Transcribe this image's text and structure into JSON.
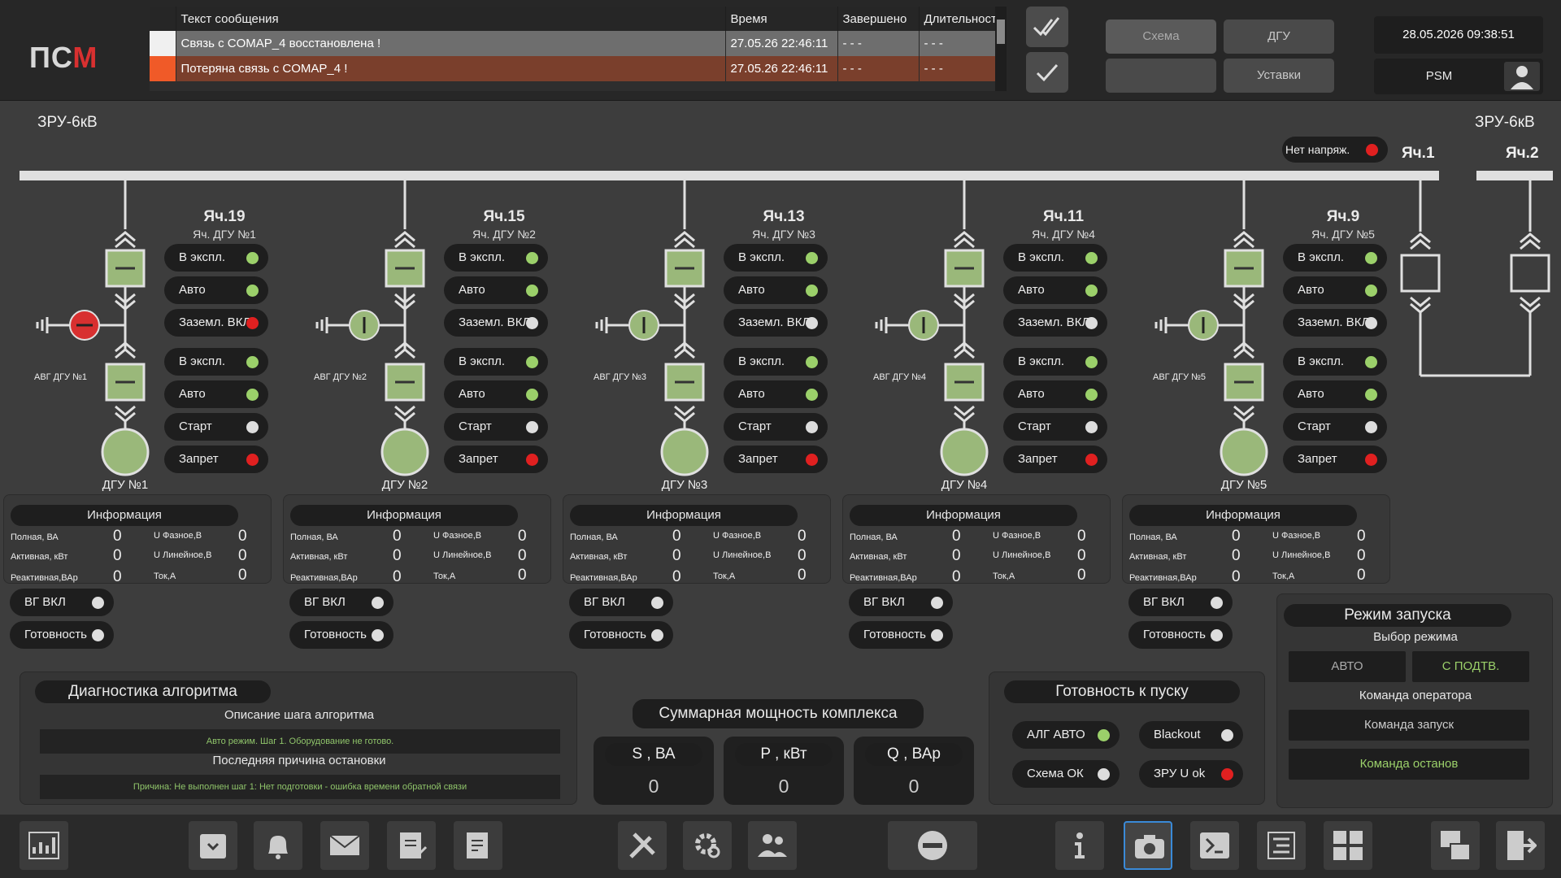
{
  "header": {
    "logo": {
      "left": "ПС",
      "right": "М"
    },
    "alarm_table": {
      "columns": [
        "Текст сообщения",
        "Время",
        "Завершено",
        "Длительность"
      ],
      "rows": [
        {
          "color": "#f0f0f0",
          "text": "Связь с COMAP_4 восстановлена !",
          "time": "27.05.26  22:46:11",
          "done": "- - -",
          "duration": "- - -"
        },
        {
          "color": "#f05a28",
          "text": "Потеряна связь с COMAP_4 !",
          "time": "27.05.26  22:46:11",
          "done": "- - -",
          "duration": "- - -"
        }
      ]
    },
    "nav": {
      "schema": "Схема",
      "dgu": "ДГУ",
      "empty": "",
      "settings": "Уставки"
    },
    "datetime": "28.05.2026  09:38:51",
    "user": "PSM"
  },
  "board": {
    "title_left": "ЗРУ-6кВ",
    "title_right": "ЗРУ-6кВ",
    "no_voltage": "Нет напряж.",
    "cell1": "Яч.1",
    "cell2": "Яч.2"
  },
  "units": [
    {
      "cell": "Яч.19",
      "sub": "Яч. ДГУ №1",
      "avg": "АВГ ДГУ №1",
      "dgu": "ДГУ №1",
      "top": [
        {
          "label": "В экспл.",
          "led": "g"
        },
        {
          "label": "Авто",
          "led": "g"
        },
        {
          "label": "Заземл. ВКЛ",
          "led": "r"
        }
      ],
      "bot": [
        {
          "label": "В экспл.",
          "led": "g"
        },
        {
          "label": "Авто",
          "led": "g"
        },
        {
          "label": "Старт",
          "led": "w"
        },
        {
          "label": "Запрет",
          "led": "r"
        }
      ],
      "ground": "red",
      "info": {
        "title": "Информация",
        "full": "Полная, ВА",
        "active": "Активная, кВт",
        "reactive": "Реактивная,ВАр",
        "uph": "U Фазное,В",
        "ulin": "U Линейное,В",
        "cur": "Ток,А",
        "v_full": "0",
        "v_active": "0",
        "v_reactive": "0",
        "v_uph": "0",
        "v_ulin": "0",
        "v_cur": "0"
      },
      "vg": "ВГ ВКЛ",
      "ready": "Готовность"
    },
    {
      "cell": "Яч.15",
      "sub": "Яч. ДГУ №2",
      "avg": "АВГ ДГУ №2",
      "dgu": "ДГУ №2",
      "top": [
        {
          "label": "В экспл.",
          "led": "g"
        },
        {
          "label": "Авто",
          "led": "g"
        },
        {
          "label": "Заземл. ВКЛ",
          "led": "w"
        }
      ],
      "bot": [
        {
          "label": "В экспл.",
          "led": "g"
        },
        {
          "label": "Авто",
          "led": "g"
        },
        {
          "label": "Старт",
          "led": "w"
        },
        {
          "label": "Запрет",
          "led": "r"
        }
      ],
      "ground": "green",
      "info": {
        "title": "Информация",
        "full": "Полная, ВА",
        "active": "Активная, кВт",
        "reactive": "Реактивная,ВАр",
        "uph": "U Фазное,В",
        "ulin": "U Линейное,В",
        "cur": "Ток,А",
        "v_full": "0",
        "v_active": "0",
        "v_reactive": "0",
        "v_uph": "0",
        "v_ulin": "0",
        "v_cur": "0"
      },
      "vg": "ВГ ВКЛ",
      "ready": "Готовность"
    },
    {
      "cell": "Яч.13",
      "sub": "Яч. ДГУ №3",
      "avg": "АВГ ДГУ №3",
      "dgu": "ДГУ №3",
      "top": [
        {
          "label": "В экспл.",
          "led": "g"
        },
        {
          "label": "Авто",
          "led": "g"
        },
        {
          "label": "Заземл. ВКЛ",
          "led": "w"
        }
      ],
      "bot": [
        {
          "label": "В экспл.",
          "led": "g"
        },
        {
          "label": "Авто",
          "led": "g"
        },
        {
          "label": "Старт",
          "led": "w"
        },
        {
          "label": "Запрет",
          "led": "r"
        }
      ],
      "ground": "green",
      "info": {
        "title": "Информация",
        "full": "Полная, ВА",
        "active": "Активная, кВт",
        "reactive": "Реактивная,ВАр",
        "uph": "U Фазное,В",
        "ulin": "U Линейное,В",
        "cur": "Ток,А",
        "v_full": "0",
        "v_active": "0",
        "v_reactive": "0",
        "v_uph": "0",
        "v_ulin": "0",
        "v_cur": "0"
      },
      "vg": "ВГ ВКЛ",
      "ready": "Готовность"
    },
    {
      "cell": "Яч.11",
      "sub": "Яч. ДГУ №4",
      "avg": "АВГ ДГУ №4",
      "dgu": "ДГУ №4",
      "top": [
        {
          "label": "В экспл.",
          "led": "g"
        },
        {
          "label": "Авто",
          "led": "g"
        },
        {
          "label": "Заземл. ВКЛ",
          "led": "w"
        }
      ],
      "bot": [
        {
          "label": "В экспл.",
          "led": "g"
        },
        {
          "label": "Авто",
          "led": "g"
        },
        {
          "label": "Старт",
          "led": "w"
        },
        {
          "label": "Запрет",
          "led": "r"
        }
      ],
      "ground": "green",
      "info": {
        "title": "Информация",
        "full": "Полная, ВА",
        "active": "Активная, кВт",
        "reactive": "Реактивная,ВАр",
        "uph": "U Фазное,В",
        "ulin": "U Линейное,В",
        "cur": "Ток,А",
        "v_full": "0",
        "v_active": "0",
        "v_reactive": "0",
        "v_uph": "0",
        "v_ulin": "0",
        "v_cur": "0"
      },
      "vg": "ВГ ВКЛ",
      "ready": "Готовность"
    },
    {
      "cell": "Яч.9",
      "sub": "Яч. ДГУ №5",
      "avg": "АВГ ДГУ №5",
      "dgu": "ДГУ №5",
      "top": [
        {
          "label": "В экспл.",
          "led": "g"
        },
        {
          "label": "Авто",
          "led": "g"
        },
        {
          "label": "Заземл. ВКЛ",
          "led": "w"
        }
      ],
      "bot": [
        {
          "label": "В экспл.",
          "led": "g"
        },
        {
          "label": "Авто",
          "led": "g"
        },
        {
          "label": "Старт",
          "led": "w"
        },
        {
          "label": "Запрет",
          "led": "r"
        }
      ],
      "ground": "green",
      "info": {
        "title": "Информация",
        "full": "Полная, ВА",
        "active": "Активная, кВт",
        "reactive": "Реактивная,ВАр",
        "uph": "U Фазное,В",
        "ulin": "U Линейное,В",
        "cur": "Ток,А",
        "v_full": "0",
        "v_active": "0",
        "v_reactive": "0",
        "v_uph": "0",
        "v_ulin": "0",
        "v_cur": "0"
      },
      "vg": "ВГ ВКЛ",
      "ready": "Готовность"
    }
  ],
  "diag": {
    "title": "Диагностика алгоритма",
    "step_label": "Описание шага алгоритма",
    "step_text": "Авто режим. Шаг 1. Оборудование не готово.",
    "stop_label": "Последняя причина остановки",
    "stop_text": "Причина: Не выполнен шаг 1: Нет подготовки - ошибка времени обратной связи"
  },
  "power": {
    "title": "Суммарная мощность комплекса",
    "s_label": "S , ВА",
    "s_value": "0",
    "p_label": "P , кВт",
    "p_value": "0",
    "q_label": "Q , ВАр",
    "q_value": "0"
  },
  "readiness": {
    "title": "Готовность к пуску",
    "items": [
      {
        "label": "АЛГ АВТО",
        "led": "g"
      },
      {
        "label": "Blackout",
        "led": "w"
      },
      {
        "label": "Схема ОК",
        "led": "w"
      },
      {
        "label": "ЗРУ U ok",
        "led": "r"
      }
    ]
  },
  "mode": {
    "title": "Режим запуска",
    "select_label": "Выбор режима",
    "auto": "АВТО",
    "confirm": "С ПОДТВ.",
    "operator_label": "Команда оператора",
    "start": "Команда запуск",
    "stop": "Команда останов"
  },
  "footer_icons": [
    "chart-icon",
    "archive-icon",
    "bell-icon",
    "mail-icon",
    "clipboard-check-icon",
    "report-icon",
    "tools-icon",
    "gear-search-icon",
    "users-icon",
    "stop-icon",
    "info-icon",
    "camera-icon",
    "terminal-icon",
    "checklist-icon",
    "grid-icon",
    "window-switch-icon",
    "exit-icon"
  ]
}
